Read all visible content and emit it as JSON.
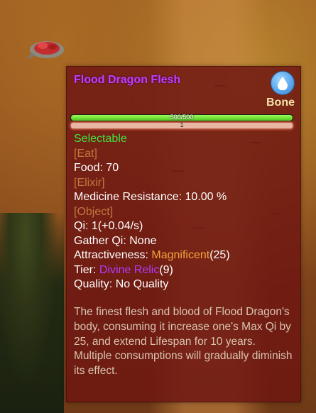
{
  "tooltip": {
    "title": "Flood Dragon Flesh",
    "badge_label": "Bone",
    "hp_bar": {
      "text": "500/500",
      "value": 500,
      "max": 500
    },
    "qty_bar": {
      "text": "1"
    },
    "selectable": "Selectable",
    "sections": {
      "eat": "[Eat]",
      "elixir": "[Elixir]",
      "object": "[Object]"
    },
    "food": "Food: 70",
    "medicine_resistance": "Medicine Resistance: 10.00 %",
    "qi": "Qi: 1(+0.04/s)",
    "gather_qi": "Gather Qi: None",
    "attractiveness_label": "Attractiveness: ",
    "attractiveness_value": "Magnificent",
    "attractiveness_num": "(25)",
    "tier_label": "Tier: ",
    "tier_value": "Divine Relic",
    "tier_num": "(9)",
    "quality": "Quality: No Quality",
    "description": "The finest flesh and blood of Flood Dragon's body, consuming it increase one's Max Qi by 25, and extend Lifespan for 10 years. Multiple consumptions will gradually diminish its effect."
  },
  "colors": {
    "title": "#c13fff",
    "selectable": "#3fe63f",
    "section": "#c2783e",
    "orange": "#f3a53a",
    "purple": "#b23cff",
    "panel": "#6e1612"
  },
  "icons": {
    "badge": "water-drop-icon"
  }
}
